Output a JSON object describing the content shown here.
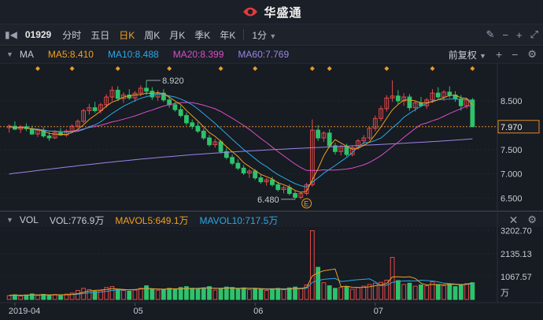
{
  "app": {
    "title": "华盛通"
  },
  "toolbar": {
    "code": "01929",
    "periods": [
      "分时",
      "五日",
      "日K",
      "周K",
      "月K",
      "季K",
      "年K"
    ],
    "active_period": "日K",
    "minute": "1分"
  },
  "ma_legend": {
    "label": "MA",
    "items": [
      {
        "text": "MA5:8.410",
        "color": "#f0a020"
      },
      {
        "text": "MA10:8.488",
        "color": "#29a9e6"
      },
      {
        "text": "MA20:8.399",
        "color": "#d84fc7"
      },
      {
        "text": "MA60:7.769",
        "color": "#9b85e8"
      }
    ],
    "adjust": "前复权"
  },
  "vol_legend": {
    "label": "VOL",
    "items": [
      {
        "text": "VOL:776.9万",
        "color": "#c8ccd4"
      },
      {
        "text": "MAVOL5:649.1万",
        "color": "#f0a020"
      },
      {
        "text": "MAVOL10:717.5万",
        "color": "#29a9e6"
      }
    ]
  },
  "colors": {
    "up": "#e24a4a",
    "down": "#2ec26b",
    "bg": "#171b22",
    "grid": "#2a2f39",
    "ref": "#e08a2a"
  },
  "price_axis": {
    "ticks": [
      "8.500",
      "8.000",
      "7.500",
      "7.000",
      "6.500"
    ],
    "current": "7.970",
    "high_label": "8.920",
    "low_label": "6.480",
    "event_marker": "E"
  },
  "volume_axis": {
    "ticks": [
      "3202.70",
      "2135.13",
      "1067.57"
    ],
    "unit": "万"
  },
  "date_axis": {
    "ticks": [
      "2019-04",
      "05",
      "06",
      "07"
    ]
  },
  "chart_data": {
    "type": "candlestick",
    "price_range": [
      6.3,
      9.05
    ],
    "volume_range": [
      0,
      3300
    ],
    "candles": [
      [
        7.95,
        8.02,
        7.85,
        7.98
      ],
      [
        7.98,
        8.08,
        7.9,
        7.92
      ],
      [
        7.92,
        8.0,
        7.84,
        7.97
      ],
      [
        7.97,
        8.04,
        7.88,
        7.93
      ],
      [
        7.93,
        7.99,
        7.8,
        7.82
      ],
      [
        7.82,
        7.92,
        7.76,
        7.9
      ],
      [
        7.9,
        7.96,
        7.74,
        7.78
      ],
      [
        7.78,
        7.86,
        7.68,
        7.74
      ],
      [
        7.74,
        7.9,
        7.72,
        7.85
      ],
      [
        7.85,
        7.94,
        7.78,
        7.8
      ],
      [
        7.8,
        7.92,
        7.76,
        7.88
      ],
      [
        7.88,
        8.02,
        7.84,
        7.98
      ],
      [
        7.98,
        8.12,
        7.94,
        8.08
      ],
      [
        8.08,
        8.34,
        8.04,
        8.3
      ],
      [
        8.3,
        8.44,
        8.22,
        8.36
      ],
      [
        8.36,
        8.48,
        8.26,
        8.3
      ],
      [
        8.3,
        8.46,
        8.24,
        8.42
      ],
      [
        8.42,
        8.64,
        8.36,
        8.58
      ],
      [
        8.58,
        8.8,
        8.5,
        8.72
      ],
      [
        8.72,
        8.8,
        8.5,
        8.55
      ],
      [
        8.55,
        8.68,
        8.46,
        8.62
      ],
      [
        8.62,
        8.74,
        8.52,
        8.56
      ],
      [
        8.56,
        8.7,
        8.48,
        8.66
      ],
      [
        8.66,
        8.82,
        8.6,
        8.76
      ],
      [
        8.76,
        8.92,
        8.62,
        8.7
      ],
      [
        8.7,
        8.78,
        8.52,
        8.58
      ],
      [
        8.58,
        8.72,
        8.5,
        8.66
      ],
      [
        8.66,
        8.74,
        8.48,
        8.52
      ],
      [
        8.52,
        8.6,
        8.36,
        8.42
      ],
      [
        8.42,
        8.48,
        8.28,
        8.32
      ],
      [
        8.32,
        8.4,
        8.16,
        8.2
      ],
      [
        8.2,
        8.26,
        8.0,
        8.05
      ],
      [
        8.05,
        8.12,
        7.92,
        7.98
      ],
      [
        7.98,
        8.06,
        7.84,
        7.88
      ],
      [
        7.88,
        7.94,
        7.7,
        7.74
      ],
      [
        7.74,
        7.8,
        7.56,
        7.6
      ],
      [
        7.6,
        7.72,
        7.54,
        7.66
      ],
      [
        7.66,
        7.7,
        7.42,
        7.46
      ],
      [
        7.46,
        7.54,
        7.3,
        7.34
      ],
      [
        7.34,
        7.4,
        7.18,
        7.22
      ],
      [
        7.22,
        7.3,
        7.08,
        7.12
      ],
      [
        7.12,
        7.18,
        6.98,
        7.02
      ],
      [
        7.02,
        7.1,
        6.92,
        7.06
      ],
      [
        7.06,
        7.1,
        6.88,
        6.92
      ],
      [
        6.92,
        6.98,
        6.8,
        6.84
      ],
      [
        6.84,
        6.92,
        6.76,
        6.88
      ],
      [
        6.88,
        6.94,
        6.74,
        6.78
      ],
      [
        6.78,
        6.84,
        6.64,
        6.68
      ],
      [
        6.68,
        6.76,
        6.6,
        6.72
      ],
      [
        6.72,
        6.78,
        6.56,
        6.6
      ],
      [
        6.6,
        6.66,
        6.48,
        6.52
      ],
      [
        6.52,
        6.64,
        6.48,
        6.6
      ],
      [
        6.6,
        6.82,
        6.56,
        6.78
      ],
      [
        6.78,
        8.12,
        6.74,
        7.9
      ],
      [
        7.9,
        8.0,
        7.68,
        7.74
      ],
      [
        7.74,
        7.88,
        7.66,
        7.84
      ],
      [
        7.84,
        7.92,
        7.54,
        7.58
      ],
      [
        7.58,
        7.64,
        7.4,
        7.46
      ],
      [
        7.46,
        7.6,
        7.38,
        7.56
      ],
      [
        7.56,
        7.62,
        7.36,
        7.4
      ],
      [
        7.4,
        7.58,
        7.36,
        7.54
      ],
      [
        7.54,
        7.72,
        7.5,
        7.68
      ],
      [
        7.68,
        7.8,
        7.6,
        7.74
      ],
      [
        7.74,
        7.98,
        7.7,
        7.94
      ],
      [
        7.94,
        8.2,
        7.88,
        8.14
      ],
      [
        8.14,
        8.4,
        8.08,
        8.34
      ],
      [
        8.34,
        8.62,
        8.28,
        8.56
      ],
      [
        8.56,
        8.92,
        8.48,
        8.6
      ],
      [
        8.6,
        8.72,
        8.44,
        8.5
      ],
      [
        8.5,
        8.66,
        8.4,
        8.58
      ],
      [
        8.58,
        8.64,
        8.3,
        8.36
      ],
      [
        8.36,
        8.5,
        8.28,
        8.46
      ],
      [
        8.46,
        8.58,
        8.38,
        8.4
      ],
      [
        8.4,
        8.56,
        8.34,
        8.52
      ],
      [
        8.52,
        8.74,
        8.46,
        8.66
      ],
      [
        8.66,
        8.78,
        8.54,
        8.58
      ],
      [
        8.58,
        8.72,
        8.5,
        8.68
      ],
      [
        8.68,
        8.8,
        8.56,
        8.62
      ],
      [
        8.62,
        8.7,
        8.48,
        8.54
      ],
      [
        8.54,
        8.62,
        8.3,
        8.4
      ],
      [
        8.4,
        8.56,
        8.34,
        8.52
      ],
      [
        8.52,
        8.56,
        7.96,
        7.97
      ]
    ],
    "volumes": [
      180,
      220,
      160,
      210,
      260,
      190,
      240,
      200,
      230,
      180,
      250,
      300,
      420,
      520,
      460,
      380,
      420,
      560,
      600,
      480,
      420,
      390,
      440,
      520,
      640,
      500,
      430,
      470,
      520,
      480,
      560,
      600,
      520,
      480,
      540,
      600,
      440,
      520,
      580,
      560,
      500,
      540,
      460,
      520,
      480,
      420,
      500,
      520,
      460,
      540,
      580,
      520,
      680,
      3202,
      1500,
      780,
      640,
      520,
      560,
      600,
      480,
      560,
      620,
      700,
      760,
      800,
      900,
      1960,
      880,
      700,
      760,
      620,
      680,
      640,
      820,
      700,
      640,
      720,
      600,
      680,
      740,
      780
    ],
    "ma5_vol": [
      200,
      205,
      198,
      205,
      208,
      216,
      220,
      216,
      224,
      220,
      220,
      240,
      276,
      336,
      394,
      426,
      440,
      468,
      508,
      488,
      468,
      450,
      460,
      496,
      520,
      500,
      488,
      478,
      500,
      494,
      490,
      514,
      516,
      520,
      544,
      548,
      516,
      520,
      536,
      544,
      508,
      530,
      520,
      520,
      500,
      478,
      484,
      488,
      478,
      486,
      520,
      516,
      564,
      1100,
      1240,
      1340,
      1380,
      1420,
      600,
      620,
      570,
      560,
      564,
      592,
      640,
      688,
      744,
      1050,
      1060,
      1040,
      1060,
      980,
      760,
      680,
      700,
      690,
      690,
      700,
      700,
      690,
      700,
      780
    ],
    "ma10_vol": [
      190,
      196,
      194,
      198,
      204,
      208,
      212,
      214,
      218,
      218,
      220,
      230,
      250,
      280,
      310,
      330,
      350,
      380,
      420,
      440,
      450,
      460,
      470,
      490,
      510,
      500,
      490,
      480,
      490,
      500,
      500,
      510,
      510,
      510,
      520,
      530,
      520,
      515,
      520,
      530,
      520,
      520,
      515,
      515,
      510,
      500,
      500,
      500,
      498,
      498,
      500,
      500,
      520,
      800,
      880,
      940,
      960,
      980,
      840,
      860,
      900,
      920,
      940,
      960,
      820,
      640,
      660,
      800,
      840,
      860,
      870,
      860,
      900,
      880,
      860,
      820,
      760,
      740,
      720,
      700,
      710,
      717
    ]
  }
}
